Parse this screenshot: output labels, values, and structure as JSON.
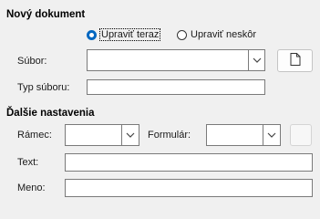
{
  "sections": {
    "new_document": "Nový dokument",
    "more_settings": "Ďalšie nastavenia"
  },
  "edit_mode": {
    "now_label": "Upraviť teraz",
    "later_label": "Upraviť neskôr",
    "selected": "now"
  },
  "file": {
    "label": "Súbor:",
    "value": "",
    "browse_icon": "document-icon"
  },
  "file_type": {
    "label": "Typ súboru:",
    "value": ""
  },
  "frame": {
    "label": "Rámec:",
    "value": ""
  },
  "form": {
    "label": "Formulár:",
    "value": ""
  },
  "text": {
    "label": "Text:",
    "value": ""
  },
  "name": {
    "label": "Meno:",
    "value": ""
  }
}
